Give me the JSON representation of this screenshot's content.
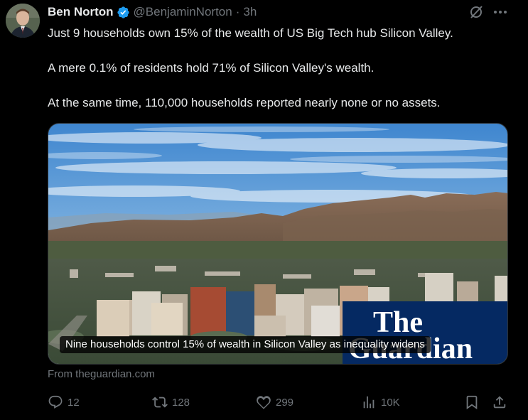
{
  "author": {
    "display_name": "Ben Norton",
    "handle": "@BenjaminNorton",
    "separator": "·",
    "time": "3h",
    "verified": true
  },
  "tweet_text": {
    "line1": "Just 9 households own 15% of the wealth of US Big Tech hub Silicon Valley.",
    "line2": "A mere 0.1% of residents hold 71% of Silicon Valley's wealth.",
    "line3": "At the same time, 110,000 households reported nearly none or no assets."
  },
  "card": {
    "caption": "Nine households control 15% of wealth in Silicon Valley as inequality widens",
    "source": "From theguardian.com",
    "logo_line1": "The",
    "logo_line2": "Guardian"
  },
  "actions": {
    "replies": "12",
    "reposts": "128",
    "likes": "299",
    "views": "10K"
  },
  "colors": {
    "background": "#000000",
    "text": "#e7e9ea",
    "muted": "#71767b",
    "verified_blue": "#1d9bf0",
    "guardian_blue": "#052962"
  },
  "icons": [
    "grok-icon",
    "more-icon",
    "verified-badge-icon",
    "reply-icon",
    "repost-icon",
    "like-icon",
    "views-icon",
    "bookmark-icon",
    "share-icon"
  ]
}
